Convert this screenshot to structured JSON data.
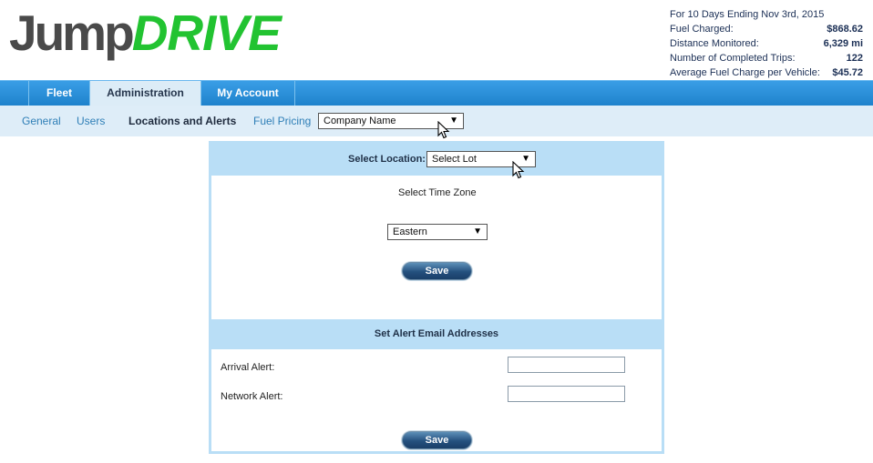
{
  "logo": {
    "part1": "Jump",
    "part2": "DRIVE"
  },
  "stats": {
    "period": "For 10 Days Ending Nov 3rd, 2015",
    "rows": [
      {
        "label": "Fuel Charged:",
        "value": "$868.62"
      },
      {
        "label": "Distance Monitored:",
        "value": "6,329 mi"
      },
      {
        "label": "Number of Completed Trips:",
        "value": "122"
      },
      {
        "label": "Average Fuel Charge per Vehicle:",
        "value": "$45.72"
      }
    ]
  },
  "nav": {
    "tabs": [
      {
        "label": "Fleet",
        "active": false
      },
      {
        "label": "Administration",
        "active": true
      },
      {
        "label": "My Account",
        "active": false
      }
    ]
  },
  "subnav": {
    "links": [
      {
        "label": "General",
        "current": false
      },
      {
        "label": "Users",
        "current": false
      },
      {
        "label": "Locations and Alerts",
        "current": true
      },
      {
        "label": "Fuel Pricing",
        "current": false
      }
    ],
    "company_select": "Company Name"
  },
  "location": {
    "label": "Select Location:",
    "select_value": "Select Lot",
    "timezone_label": "Select Time Zone",
    "timezone_value": "Eastern",
    "save_label": "Save"
  },
  "alerts": {
    "header": "Set Alert Email Addresses",
    "arrival_label": "Arrival Alert:",
    "arrival_value": "",
    "network_label": "Network Alert:",
    "network_value": "",
    "save_label": "Save"
  },
  "icons": {
    "dropdown": "dropdown-arrow-icon",
    "cursor": "mouse-pointer-icon"
  },
  "colors": {
    "nav_blue": "#2a8fd8",
    "panel_blue": "#b9def6",
    "logo_green": "#22c331",
    "logo_gray": "#4a4a4a"
  }
}
